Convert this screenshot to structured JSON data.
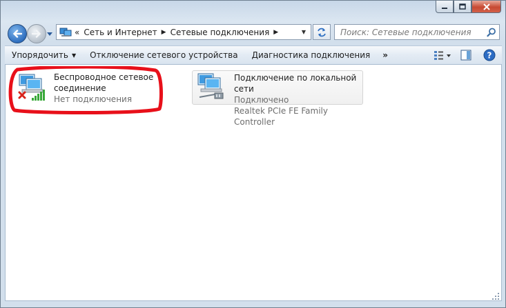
{
  "window": {
    "caption_buttons": [
      "minimize",
      "maximize",
      "close"
    ]
  },
  "address_bar": {
    "overflow": "«",
    "crumbs": [
      "Сеть и Интернет",
      "Сетевые подключения"
    ]
  },
  "search": {
    "placeholder": "Поиск: Сетевые подключения"
  },
  "command_bar": {
    "organize": "Упорядочить",
    "disable_device": "Отключение сетевого устройства",
    "diagnose": "Диагностика подключения",
    "more": "»"
  },
  "connections": [
    {
      "name_line1": "Беспроводное сетевое",
      "name_line2": "соединение",
      "status": "Нет подключения",
      "icon": "wireless-network-disconnected-icon"
    },
    {
      "name_line1": "Подключение по локальной сети",
      "status": "Подключено",
      "device": "Realtek PCIe FE Family Controller",
      "icon": "lan-network-icon"
    }
  ],
  "colors": {
    "highlight": "#e8101a",
    "status_gray": "#6d6d6d",
    "close_red": "#c74a33"
  }
}
